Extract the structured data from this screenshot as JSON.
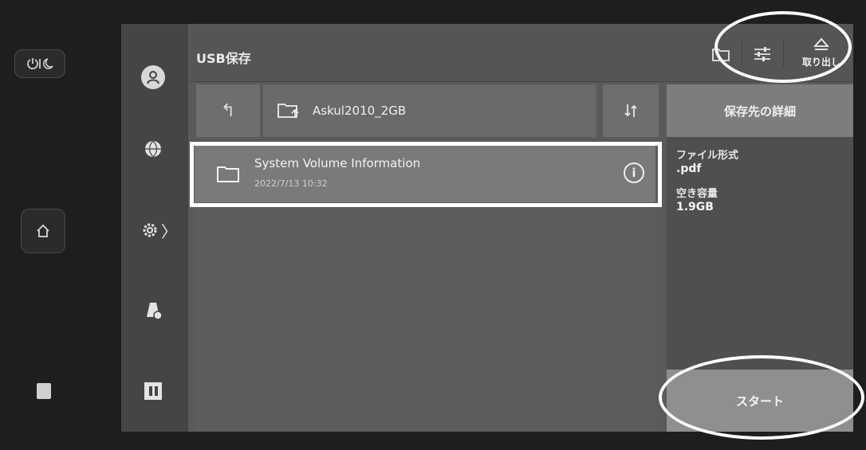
{
  "hardware": {
    "power_label": "ᏅᏓ",
    "home_icon": "home-icon",
    "nfc_icon": "nfc-icon"
  },
  "nav": {
    "items": [
      {
        "name": "user-icon"
      },
      {
        "name": "globe-icon"
      },
      {
        "name": "settings-icon",
        "chevron": "〉"
      },
      {
        "name": "printer-settings-icon"
      },
      {
        "name": "pause-icon"
      }
    ]
  },
  "header": {
    "title": "USB保存",
    "eject_label": "取り出し"
  },
  "path": {
    "up_symbol": "↰",
    "folder_name": "Askul2010_2GB"
  },
  "files": [
    {
      "name": "System Volume Information",
      "date": "2022/7/13  10:32"
    }
  ],
  "details": {
    "button_label": "保存先の詳細",
    "format_label": "ファイル形式",
    "format_value": ".pdf",
    "free_label": "空き容量",
    "free_value": "1.9GB"
  },
  "start": {
    "label": "スタート"
  }
}
